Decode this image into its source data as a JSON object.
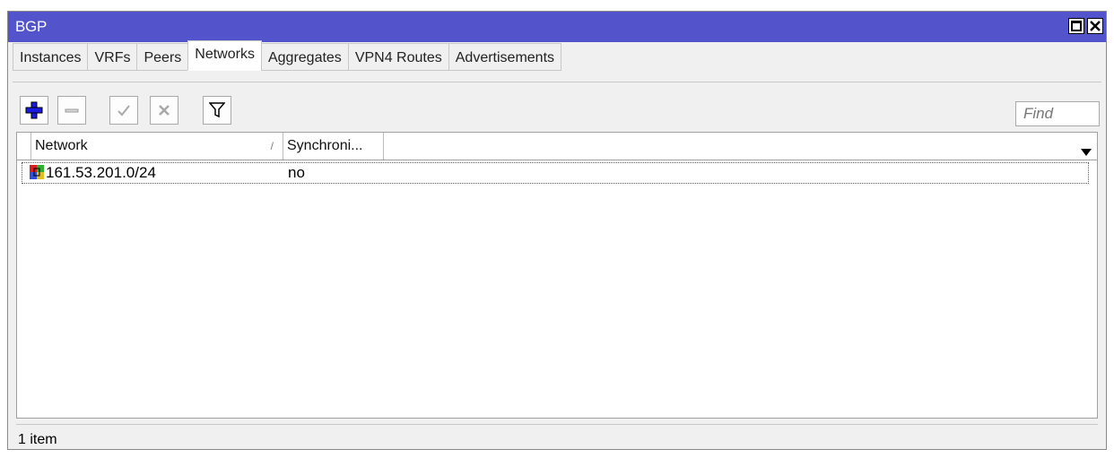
{
  "window": {
    "title": "BGP"
  },
  "tabs": [
    {
      "label": "Instances"
    },
    {
      "label": "VRFs"
    },
    {
      "label": "Peers"
    },
    {
      "label": "Networks",
      "active": true
    },
    {
      "label": "Aggregates"
    },
    {
      "label": "VPN4 Routes"
    },
    {
      "label": "Advertisements"
    }
  ],
  "toolbar": {
    "add_icon": "plus-icon",
    "remove_icon": "minus-icon",
    "enable_icon": "check-icon",
    "disable_icon": "cross-icon",
    "filter_icon": "filter-icon",
    "find_placeholder": "Find",
    "accent_add": "#1a1ae0"
  },
  "table": {
    "columns": [
      {
        "label": "Network",
        "sort_indicator": "/"
      },
      {
        "label": "Synchroni..."
      }
    ],
    "rows": [
      {
        "network": "161.53.201.0/24",
        "synchronize": "no",
        "icon": "network-entry-icon"
      }
    ]
  },
  "status": {
    "text": "1 item"
  },
  "colors": {
    "titlebar": "#5353cc",
    "title_text": "#ffffff"
  }
}
